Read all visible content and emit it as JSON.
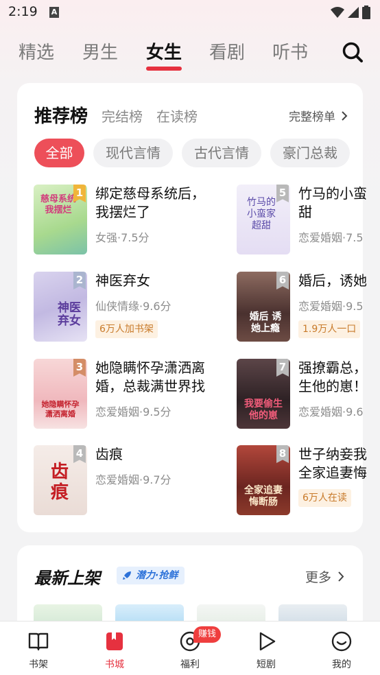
{
  "status": {
    "time": "2:19",
    "notification": "A"
  },
  "tabs": [
    "精选",
    "男生",
    "女生",
    "看剧",
    "听书"
  ],
  "rank": {
    "title": "推荐榜",
    "tabs": [
      "完结榜",
      "在读榜"
    ],
    "full_list": "完整榜单"
  },
  "chips": [
    "全部",
    "现代言情",
    "古代言情",
    "豪门总裁"
  ],
  "books": [
    {
      "rank": "1",
      "title_line1": "绑定慈母系统后，",
      "title_line2": "我摆烂了",
      "meta": "女强·7.5分",
      "tag": "",
      "cover_text": "慈母系统 我摆烂",
      "color": "#f0b53a",
      "cover_bg": "#b9e2a8"
    },
    {
      "rank": "2",
      "title_line1": "神医弃女",
      "title_line2": "",
      "meta": "仙侠情缘·9.6分",
      "tag": "6万人加书架",
      "cover_text": "神医弃女",
      "color": "#aab5cf",
      "cover_bg": "#d6cbe9"
    },
    {
      "rank": "3",
      "title_line1": "她隐瞒怀孕潇洒离",
      "title_line2": "婚，总裁满世界找",
      "meta": "恋爱婚姻·9.5分",
      "tag": "",
      "cover_text": "她隐瞒怀孕 潇洒离婚",
      "color": "#d48d67",
      "cover_bg": "#f4c6c9"
    },
    {
      "rank": "4",
      "title_line1": "齿痕",
      "title_line2": "",
      "meta": "恋爱婚姻·9.7分",
      "tag": "",
      "cover_text": "齿痕",
      "color": "#b9b9b9",
      "cover_bg": "#f1e4df"
    },
    {
      "rank": "5",
      "title_line1": "竹马的小蛮",
      "title_line2": "甜",
      "meta": "恋爱婚姻·7.5",
      "tag": "",
      "cover_text": "竹马的 小蛮家 超甜",
      "color": "#b9b9b9",
      "cover_bg": "#ece8f6"
    },
    {
      "rank": "6",
      "title_line1": "婚后，诱她",
      "title_line2": "",
      "meta": "恋爱婚姻·9.5",
      "tag": "1.9万人一口",
      "cover_text": "婚后 诱她上瘾",
      "color": "#b9b9b9",
      "cover_bg": "#5a3e3a"
    },
    {
      "rank": "7",
      "title_line1": "强撩霸总，",
      "title_line2": "生他的崽！",
      "meta": "恋爱婚姻·9.6",
      "tag": "",
      "cover_text": "我要偷生 他的崽",
      "color": "#b9b9b9",
      "cover_bg": "#3c2b2f"
    },
    {
      "rank": "8",
      "title_line1": "世子纳妾我",
      "title_line2": "全家追妻悔",
      "meta": "",
      "tag": "6万人在读",
      "cover_text": "全家追妻 悔断肠",
      "color": "#b9b9b9",
      "cover_bg": "#6a2d25"
    }
  ],
  "new_section": {
    "title": "最新上架",
    "badge": "潜力·抢鲜",
    "more": "更多"
  },
  "bottom_nav": [
    {
      "label": "书架",
      "icon": "book-icon"
    },
    {
      "label": "书城",
      "icon": "bookstore-icon"
    },
    {
      "label": "福利",
      "icon": "coin-icon"
    },
    {
      "label": "短剧",
      "icon": "play-icon"
    },
    {
      "label": "我的",
      "icon": "smile-icon"
    }
  ],
  "earn_badge": "赚钱",
  "colors": {
    "accent": "#e6313f",
    "chip_active": "#ed4f59",
    "tag_text": "#c87a2a"
  }
}
